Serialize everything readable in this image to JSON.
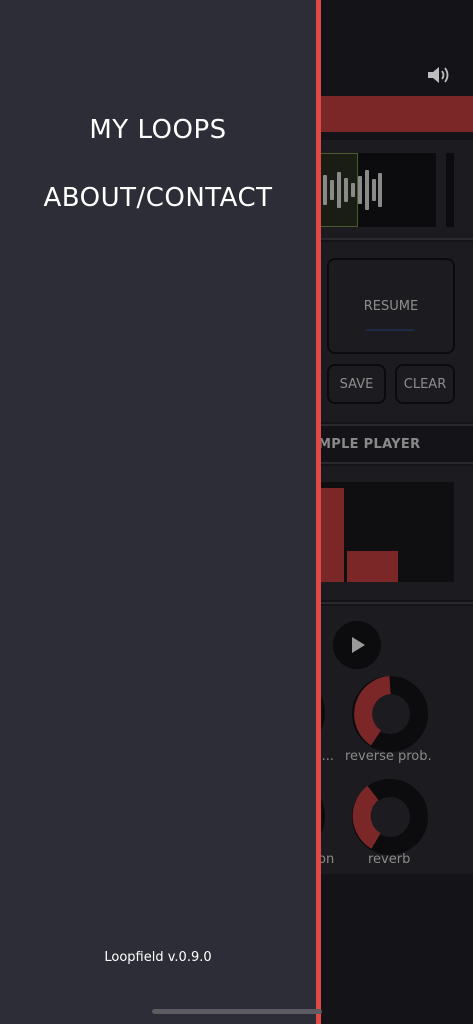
{
  "drawer": {
    "menu_items": [
      "MY LOOPS",
      "ABOUT/CONTACT"
    ],
    "version": "Loopfield v.0.9.0"
  },
  "app": {
    "buttons": {
      "resume": "RESUME",
      "save": "SAVE",
      "clear": "CLEAR"
    },
    "section_label": "MPLE PLAYER",
    "knob_labels": [
      "i...",
      "reverse prob.",
      "on",
      "reverb"
    ],
    "knob_levels": {
      "reverse_prob": 0.45,
      "reverb": 0.3
    },
    "colors": {
      "accent_red": "#7b2727",
      "drawer_edge": "#e04a45",
      "drawer_bg": "#2d2d37"
    },
    "icons": [
      "speaker-icon",
      "play-icon"
    ]
  }
}
